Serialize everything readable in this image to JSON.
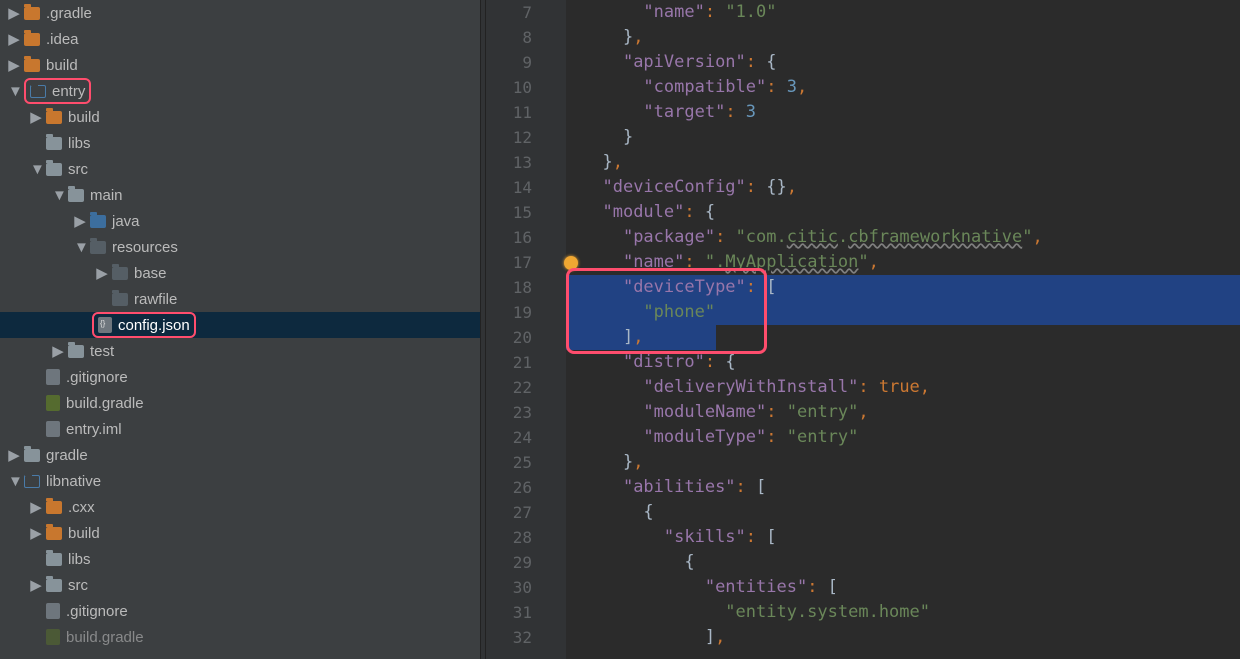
{
  "tree": {
    "gradle_dir": ".gradle",
    "idea_dir": ".idea",
    "build_dir": "build",
    "entry_dir": "entry",
    "entry_build": "build",
    "entry_libs": "libs",
    "entry_src": "src",
    "entry_main": "main",
    "entry_java": "java",
    "entry_resources": "resources",
    "entry_base": "base",
    "entry_rawfile": "rawfile",
    "entry_config": "config.json",
    "entry_test": "test",
    "entry_gitignore": ".gitignore",
    "entry_buildgradle": "build.gradle",
    "entry_iml": "entry.iml",
    "gradle2": "gradle",
    "libnative": "libnative",
    "lib_cxx": ".cxx",
    "lib_build": "build",
    "lib_libs": "libs",
    "lib_src": "src",
    "lib_gitignore": ".gitignore",
    "lib_buildgradle": "build.gradle"
  },
  "lines": {
    "l7": "7",
    "l8": "8",
    "l9": "9",
    "l10": "10",
    "l11": "11",
    "l12": "12",
    "l13": "13",
    "l14": "14",
    "l15": "15",
    "l16": "16",
    "l17": "17",
    "l18": "18",
    "l19": "19",
    "l20": "20",
    "l21": "21",
    "l22": "22",
    "l23": "23",
    "l24": "24",
    "l25": "25",
    "l26": "26",
    "l27": "27",
    "l28": "28",
    "l29": "29",
    "l30": "30",
    "l31": "31",
    "l32": "32"
  },
  "code": {
    "name_key": "\"name\"",
    "name_val": "\"1.0\"",
    "apiVersion": "\"apiVersion\"",
    "compatible": "\"compatible\"",
    "compatible_v": "3",
    "target": "\"target\"",
    "target_v": "3",
    "deviceConfig": "\"deviceConfig\"",
    "module": "\"module\"",
    "package": "\"package\"",
    "package_v1": "\"com.",
    "package_v2": "citic",
    "package_v3": ".",
    "package_v4": "cbframeworknative",
    "package_v5": "\"",
    "mod_name": "\"name\"",
    "mod_name_v1": "\".",
    "mod_name_v2": "MyApplication",
    "mod_name_v3": "\"",
    "deviceType": "\"deviceType\"",
    "phone": "\"phone\"",
    "distro": "\"distro\"",
    "delivery": "\"deliveryWithInstall\"",
    "true": "true",
    "moduleName": "\"moduleName\"",
    "entry": "\"entry\"",
    "moduleType": "\"moduleType\"",
    "abilities": "\"abilities\"",
    "skills": "\"skills\"",
    "entities": "\"entities\"",
    "entity_home": "\"entity.system.home\""
  }
}
